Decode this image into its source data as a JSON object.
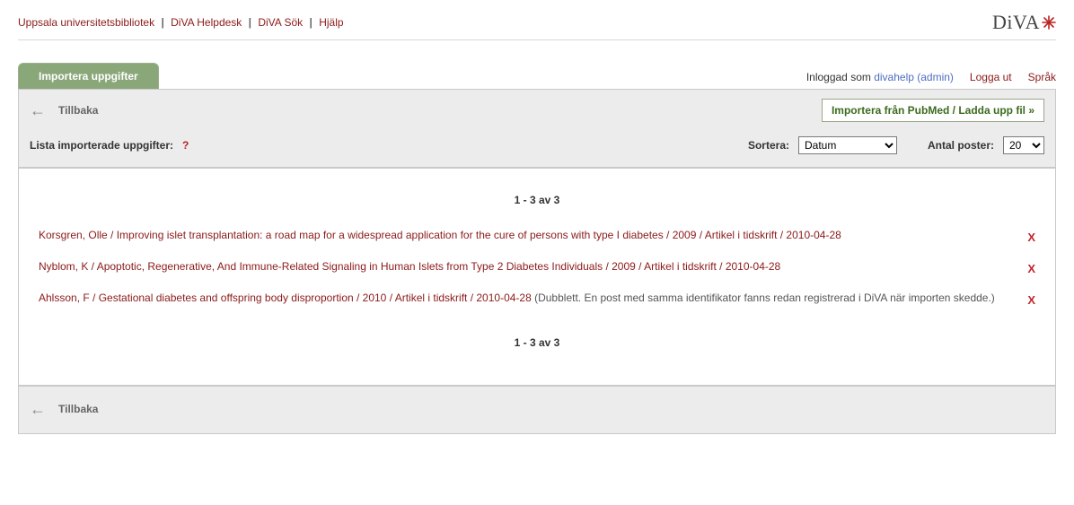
{
  "top_links": {
    "lib": "Uppsala universitetsbibliotek",
    "help": "DiVA Helpdesk",
    "search": "DiVA Sök",
    "hjalp": "Hjälp"
  },
  "logo_text": "DiVA",
  "tab_label": "Importera uppgifter",
  "login": {
    "prefix": "Inloggad som",
    "user": "divahelp (admin)",
    "logout": "Logga ut",
    "lang": "Språk"
  },
  "back_label": "Tillbaka",
  "import_button": "Importera från PubMed / Ladda upp fil »",
  "list_label": "Lista importerade uppgifter:",
  "list_help_mark": "?",
  "sort_label": "Sortera:",
  "sort_value": "Datum",
  "count_label": "Antal poster:",
  "count_value": "20",
  "pager_text": "1 - 3 av 3",
  "items": [
    {
      "link": "Korsgren, Olle / Improving islet transplantation: a road map for a widespread application for the cure of persons with type I diabetes / 2009 / Artikel i tidskrift / 2010-04-28",
      "note": ""
    },
    {
      "link": "Nyblom, K / Apoptotic, Regenerative, And Immune-Related Signaling in Human Islets from Type 2 Diabetes Individuals / 2009 / Artikel i tidskrift / 2010-04-28",
      "note": ""
    },
    {
      "link": "Ahlsson, F / Gestational diabetes and offspring body disproportion / 2010 / Artikel i tidskrift / 2010-04-28",
      "note": " (Dubblett. En post med samma identifikator fanns redan registrerad i DiVA när importen skedde.)"
    }
  ],
  "delete_glyph": "X"
}
